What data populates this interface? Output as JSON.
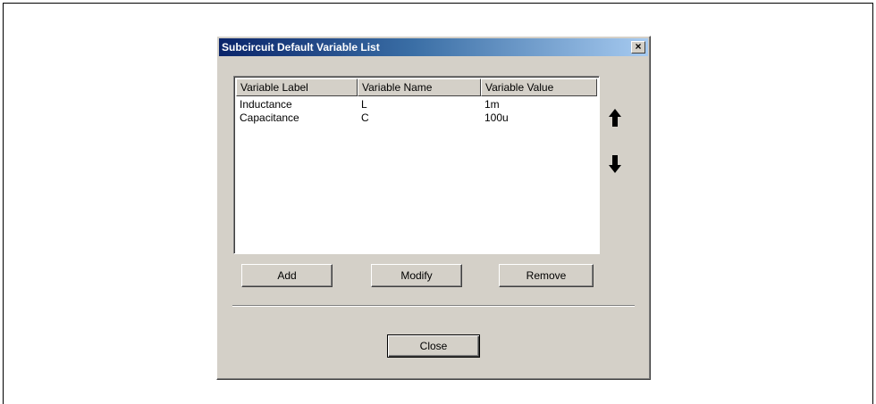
{
  "dialog": {
    "title": "Subcircuit Default Variable List",
    "close_glyph": "×"
  },
  "table": {
    "columns": [
      "Variable Label",
      "Variable Name",
      "Variable Value"
    ],
    "rows": [
      {
        "label": "Inductance",
        "name": "L",
        "value": "1m"
      },
      {
        "label": "Capacitance",
        "name": "C",
        "value": "100u"
      }
    ]
  },
  "buttons": {
    "add": "Add",
    "modify": "Modify",
    "remove": "Remove",
    "close": "Close"
  },
  "icons": {
    "move_up": "arrow-up-icon",
    "move_down": "arrow-down-icon"
  }
}
